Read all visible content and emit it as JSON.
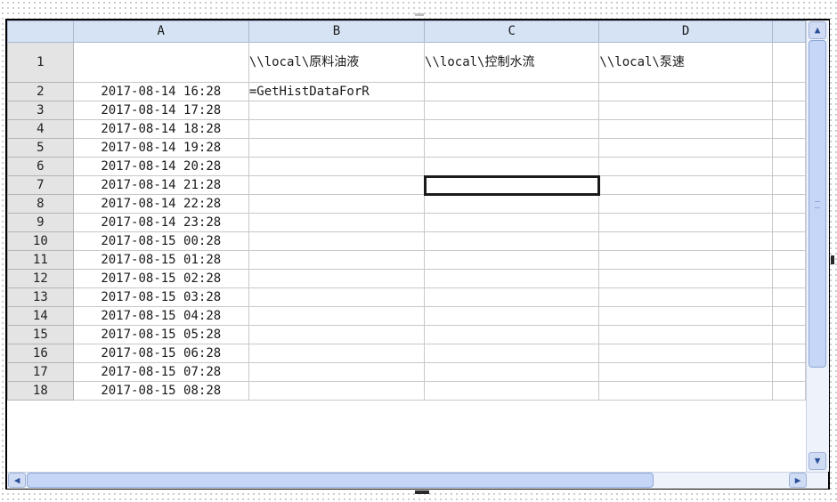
{
  "columns": [
    "A",
    "B",
    "C",
    "D"
  ],
  "rows": [
    {
      "num": "1",
      "a": "",
      "b": "\\\\local\\原料油液",
      "c": "\\\\local\\控制水流",
      "d": "\\\\local\\泵速"
    },
    {
      "num": "2",
      "a": "2017-08-14 16:28",
      "b": "=GetHistDataForR",
      "c": "",
      "d": ""
    },
    {
      "num": "3",
      "a": "2017-08-14 17:28",
      "b": "",
      "c": "",
      "d": ""
    },
    {
      "num": "4",
      "a": "2017-08-14 18:28",
      "b": "",
      "c": "",
      "d": ""
    },
    {
      "num": "5",
      "a": "2017-08-14 19:28",
      "b": "",
      "c": "",
      "d": ""
    },
    {
      "num": "6",
      "a": "2017-08-14 20:28",
      "b": "",
      "c": "",
      "d": ""
    },
    {
      "num": "7",
      "a": "2017-08-14 21:28",
      "b": "",
      "c": "",
      "d": ""
    },
    {
      "num": "8",
      "a": "2017-08-14 22:28",
      "b": "",
      "c": "",
      "d": ""
    },
    {
      "num": "9",
      "a": "2017-08-14 23:28",
      "b": "",
      "c": "",
      "d": ""
    },
    {
      "num": "10",
      "a": "2017-08-15 00:28",
      "b": "",
      "c": "",
      "d": ""
    },
    {
      "num": "11",
      "a": "2017-08-15 01:28",
      "b": "",
      "c": "",
      "d": ""
    },
    {
      "num": "12",
      "a": "2017-08-15 02:28",
      "b": "",
      "c": "",
      "d": ""
    },
    {
      "num": "13",
      "a": "2017-08-15 03:28",
      "b": "",
      "c": "",
      "d": ""
    },
    {
      "num": "14",
      "a": "2017-08-15 04:28",
      "b": "",
      "c": "",
      "d": ""
    },
    {
      "num": "15",
      "a": "2017-08-15 05:28",
      "b": "",
      "c": "",
      "d": ""
    },
    {
      "num": "16",
      "a": "2017-08-15 06:28",
      "b": "",
      "c": "",
      "d": ""
    },
    {
      "num": "17",
      "a": "2017-08-15 07:28",
      "b": "",
      "c": "",
      "d": ""
    },
    {
      "num": "18",
      "a": "2017-08-15 08:28",
      "b": "",
      "c": "",
      "d": ""
    }
  ],
  "selected_cell": "C7",
  "scrollbar": {
    "up_icon": "arrow-up-icon",
    "down_icon": "arrow-down-icon",
    "left_icon": "arrow-left-icon",
    "right_icon": "arrow-right-icon"
  },
  "colors": {
    "column_header": "#d6e3f5",
    "row_header": "#e4e4e4",
    "selection_border": "#1a1a1a"
  }
}
